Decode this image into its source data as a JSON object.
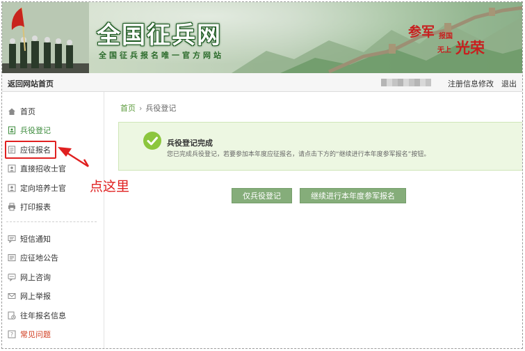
{
  "header": {
    "title": "全国征兵网",
    "subtitle": "全国征兵报名唯一官方网站",
    "slogan": {
      "a": "参军",
      "b": "报国",
      "c": "无上",
      "d": "光荣"
    }
  },
  "topbar": {
    "home_link": "返回网站首页",
    "modify_link": "注册信息修改",
    "logout_link": "退出"
  },
  "sidebar": {
    "items": [
      {
        "label": "首页",
        "icon": "home-icon"
      },
      {
        "label": "兵役登记",
        "icon": "id-card-icon",
        "active": true
      },
      {
        "label": "应征报名",
        "icon": "document-icon",
        "highlighted": true
      },
      {
        "label": "直接招收士官",
        "icon": "person-badge-icon"
      },
      {
        "label": "定向培养士官",
        "icon": "person-badge-icon"
      },
      {
        "label": "打印报表",
        "icon": "printer-icon"
      },
      {
        "label": "短信通知",
        "icon": "message-icon"
      },
      {
        "label": "应征地公告",
        "icon": "notice-icon"
      },
      {
        "label": "网上咨询",
        "icon": "chat-icon"
      },
      {
        "label": "网上举报",
        "icon": "mail-icon"
      },
      {
        "label": "往年报名信息",
        "icon": "history-icon"
      },
      {
        "label": "常见问题",
        "icon": "question-icon"
      }
    ]
  },
  "annotation": {
    "text": "点这里",
    "color": "#e02020"
  },
  "breadcrumb": {
    "home": "首页",
    "separator": "›",
    "current": "兵役登记"
  },
  "notice": {
    "title": "兵役登记完成",
    "description": "您已完成兵役登记，若要参加本年度应征报名，请点击下方的“继续进行本年度参军报名”按钮。"
  },
  "buttons": {
    "register_only": "仅兵役登记",
    "continue_enlist": "继续进行本年度参军报名"
  },
  "colors": {
    "accent_green": "#85ad7a",
    "success_bg": "#edf7e2",
    "check_green": "#8cc63e",
    "slogan_red": "#c81e1e"
  }
}
